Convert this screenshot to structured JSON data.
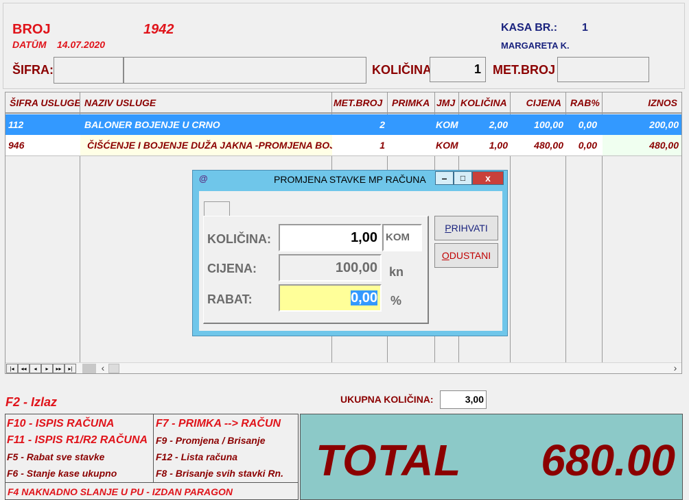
{
  "header": {
    "broj_label": "BROJ",
    "broj_value": "1942",
    "datum_label": "DATŪM",
    "datum_value": "14.07.2020",
    "kasa_label": "KASA BR.:",
    "kasa_value": "1",
    "operator": "MARGARETA K.",
    "sifra_label": "ŠIFRA:",
    "sifra_value": "",
    "naziv_value": "",
    "kolicina_label": "KOLIČINA",
    "kolicina_value": "1",
    "metbroj_label": "MET.BROJ",
    "metbroj_value": ""
  },
  "grid": {
    "columns": [
      "ŠIFRA USLUGE",
      "NAZIV USLUGE",
      "MET.BROJ",
      "PRIMKA",
      "JMJ",
      "KOLIČINA",
      "CIJENA",
      "RAB%",
      "IZNOS"
    ],
    "rows": [
      [
        "112",
        "BALONER BOJENJE U CRNO",
        "2",
        "",
        "KOM",
        "2,00",
        "100,00",
        "0,00",
        "200,00"
      ],
      [
        "946",
        "ČIŠĆENJE I BOJENJE DUŽA JAKNA -PROMJENA BOJE",
        "1",
        "",
        "KOM",
        "1,00",
        "480,00",
        "0,00",
        "480,00"
      ]
    ],
    "nav_buttons": [
      "|◂",
      "◂◂",
      "◂",
      "▸",
      "▸▸",
      "▸|"
    ],
    "scroll_left": "‹",
    "scroll_right": "›"
  },
  "dialog": {
    "app_icon": "@",
    "title": "PROMJENA STAVKE MP RAČUNA",
    "minimize": "–",
    "maximize": "□",
    "close": "x",
    "kolicina_label": "KOLIČINA:",
    "kolicina_value": "1,00",
    "kolicina_unit": "KOM",
    "cijena_label": "CIJENA:",
    "cijena_value": "100,00",
    "cijena_unit": "kn",
    "rabat_label": "RABAT:",
    "rabat_value": "0,00",
    "rabat_unit": "%",
    "accept_hotkey": "P",
    "accept_rest": "RIHVATI",
    "cancel_hotkey": "O",
    "cancel_rest": "DUSTANI"
  },
  "footer": {
    "f2": "F2 - Izlaz",
    "ukupna_label": "UKUPNA KOLIČINA:",
    "ukupna_value": "3,00",
    "f10": "F10 - ISPIS RAČUNA",
    "f11": "F11 - ISPIS R1/R2 RAČUNA",
    "f5": "F5 - Rabat sve stavke",
    "f6": "F6 - Stanje kase ukupno",
    "f7": "F7 - PRIMKA --> RAČUN",
    "f9": "F9 - Promjena / Brisanje",
    "f12": "F12 - Lista računa",
    "f8": "F8 - Brisanje svih stavki Rn.",
    "f4": "F4 NAKNADNO SLANJE U PU - IZDAN  PARAGON",
    "total_label": "TOTAL",
    "total_value": "680.00"
  },
  "colors": {
    "selected_row": "#3399ff",
    "total_bg": "#8cc9c8",
    "dialog_frame": "#6fc6ea",
    "rabat_bg": "#ffff99",
    "close_btn": "#c9403a"
  }
}
